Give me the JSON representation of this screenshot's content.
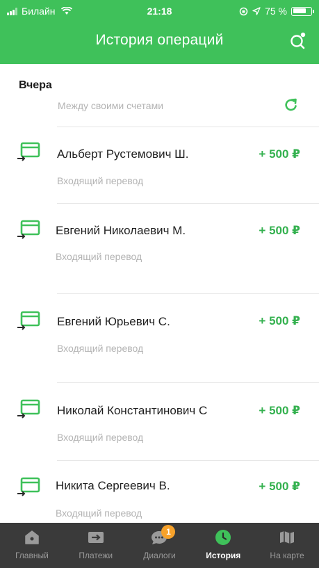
{
  "status_bar": {
    "carrier": "Билайн",
    "time": "21:18",
    "battery": "75 %",
    "battery_level": 0.75
  },
  "header": {
    "title": "История операций",
    "search_icon": "search-icon"
  },
  "section": {
    "title": "Вчера",
    "partial_item": {
      "type": "Между своими счетами",
      "icon": "refresh-icon"
    }
  },
  "operations": [
    {
      "name": "Альберт Рустемович Ш.",
      "amount": "+ 500 ₽",
      "type": "Входящий перевод",
      "icon": "incoming-transfer-icon"
    },
    {
      "name": "Евгений Николаевич М.",
      "amount": "+ 500 ₽",
      "type": "Входящий перевод",
      "icon": "incoming-transfer-icon"
    },
    {
      "name": "Евгений Юрьевич С.",
      "amount": "+ 500 ₽",
      "type": "Входящий перевод",
      "icon": "incoming-transfer-icon"
    },
    {
      "name": "Николай Константинович С",
      "amount": "+ 500 ₽",
      "type": "Входящий перевод",
      "icon": "incoming-transfer-icon"
    },
    {
      "name": "Никита Сергеевич В.",
      "amount": "+ 500 ₽",
      "type": "Входящий перевод",
      "icon": "incoming-transfer-icon"
    }
  ],
  "tabbar": {
    "tabs": [
      {
        "label": "Главный",
        "icon": "home-icon"
      },
      {
        "label": "Платежи",
        "icon": "payments-icon"
      },
      {
        "label": "Диалоги",
        "icon": "chat-icon",
        "badge": "1"
      },
      {
        "label": "История",
        "icon": "clock-icon",
        "active": true
      },
      {
        "label": "На карте",
        "icon": "map-icon"
      }
    ]
  },
  "colors": {
    "brand_green": "#3fc15a",
    "amount_green": "#34b14f",
    "tabbar_bg": "#3a3a3a",
    "badge_orange": "#f7a22b"
  }
}
